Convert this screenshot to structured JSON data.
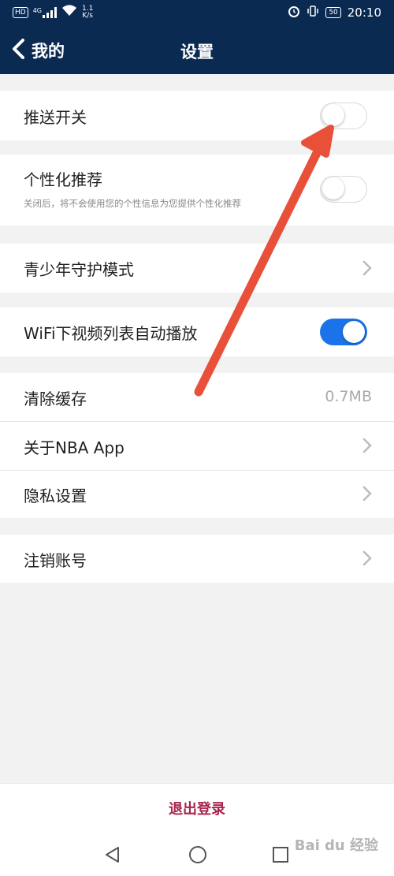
{
  "status_bar": {
    "badge": "HD",
    "network": "4G",
    "speed_value": "1.1",
    "speed_unit": "K/s",
    "battery": "50",
    "time": "20:10"
  },
  "nav": {
    "back_label": "我的",
    "title": "设置"
  },
  "settings": {
    "push_switch": {
      "label": "推送开关",
      "enabled": false
    },
    "personalized": {
      "label": "个性化推荐",
      "description": "关闭后，将不会使用您的个性信息为您提供个性化推荐",
      "enabled": false
    },
    "youth_mode": {
      "label": "青少年守护模式"
    },
    "wifi_autoplay": {
      "label": "WiFi下视频列表自动播放",
      "enabled": true
    },
    "clear_cache": {
      "label": "清除缓存",
      "value": "0.7MB"
    },
    "about": {
      "label": "关于NBA App"
    },
    "privacy": {
      "label": "隐私设置"
    },
    "cancel_account": {
      "label": "注销账号"
    }
  },
  "logout_label": "退出登录",
  "watermark": "Bai du 经验",
  "colors": {
    "header": "#0b2a52",
    "toggle_on": "#1a73e8",
    "logout": "#a8244a",
    "annotation_arrow": "#e8503a"
  }
}
